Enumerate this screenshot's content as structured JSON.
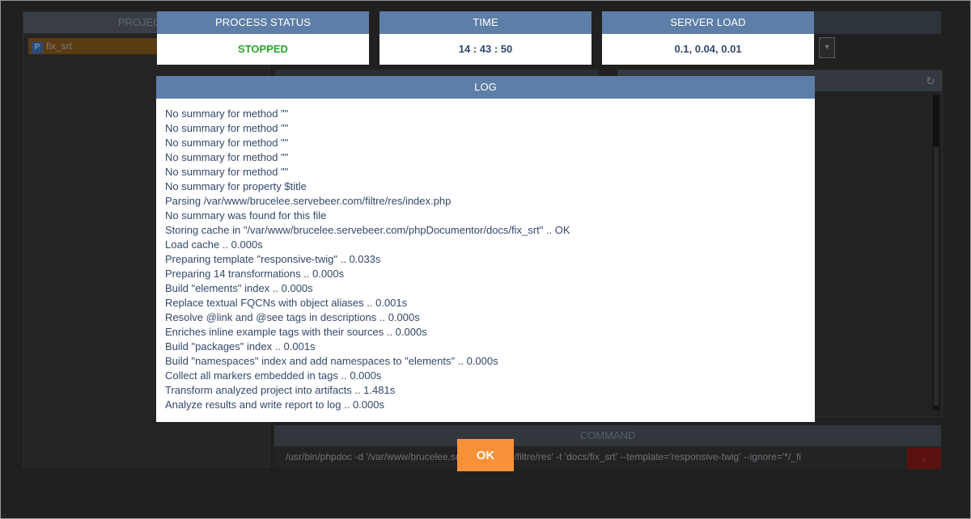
{
  "background": {
    "projects_header": "PROJECTS",
    "project_item": "fix_srt",
    "project_badge": "P",
    "command_header": "COMMAND",
    "command_text": "/usr/bin/phpdoc -d '/var/www/brucelee.servebeer.com/filtre/res' -t 'docs/fix_srt' --template='responsive-twig' --ignore='*/_fi",
    "select_arrow": "▾",
    "refresh_glyph": "↻",
    "run_glyph": "›"
  },
  "dialog": {
    "process_status": {
      "label": "PROCESS STATUS",
      "value": "STOPPED",
      "color": "#2aa52a"
    },
    "time": {
      "label": "TIME",
      "value": "14 : 43 : 50"
    },
    "server_load": {
      "label": "SERVER LOAD",
      "value": "0.1,   0.04,   0.01"
    },
    "log": {
      "label": "LOG",
      "lines": [
        "No summary for method \"\"",
        "No summary for method \"\"",
        "No summary for method \"\"",
        "No summary for method \"\"",
        "No summary for method \"\"",
        "No summary for property $title",
        "Parsing /var/www/brucelee.servebeer.com/filtre/res/index.php",
        "No summary was found for this file",
        "Storing cache in \"/var/www/brucelee.servebeer.com/phpDocumentor/docs/fix_srt\" .. OK",
        "Load cache .. 0.000s",
        "Preparing template \"responsive-twig\" .. 0.033s",
        "Preparing 14 transformations .. 0.000s",
        "Build \"elements\" index .. 0.000s",
        "Replace textual FQCNs with object aliases .. 0.001s",
        "Resolve @link and @see tags in descriptions .. 0.000s",
        "Enriches inline example tags with their sources .. 0.000s",
        "Build \"packages\" index .. 0.001s",
        "Build \"namespaces\" index and add namespaces to \"elements\" .. 0.000s",
        "Collect all markers embedded in tags .. 0.000s",
        "Transform analyzed project into artifacts .. 1.481s",
        "Analyze results and write report to log .. 0.000s"
      ]
    },
    "ok_label": "OK"
  },
  "colors": {
    "header_bg": "#5d7ea6",
    "value_text": "#34476b",
    "ok_button": "#f7923a",
    "status_stopped": "#2aa52a"
  }
}
